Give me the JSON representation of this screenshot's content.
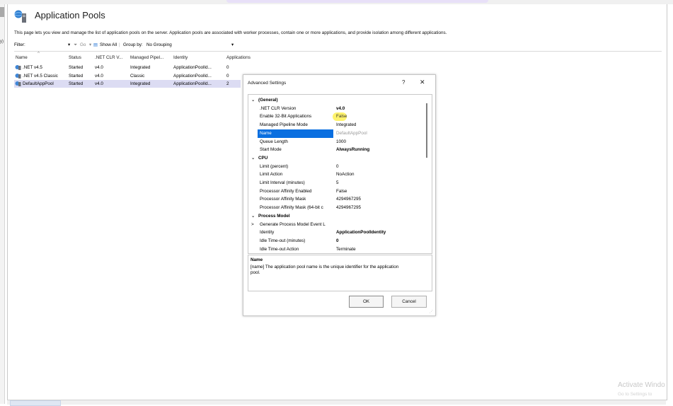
{
  "page": {
    "title": "Application Pools",
    "description": "This page lets you view and manage the list of application pools on the server. Application pools are associated with worker processes, contain one or more applications, and provide isolation among different applications."
  },
  "filterbar": {
    "filter_label": "Filter:",
    "go_label": "Go",
    "show_all_label": "Show All",
    "group_by_label": "Group by:",
    "group_by_value": "No Grouping"
  },
  "grid": {
    "columns": [
      "Name",
      "Status",
      ".NET CLR V...",
      "Managed Pipel...",
      "Identity",
      "Applications"
    ],
    "rows": [
      {
        "name": ".NET v4.5",
        "status": "Started",
        "clr": "v4.0",
        "pipeline": "Integrated",
        "identity": "ApplicationPoolId...",
        "apps": "0"
      },
      {
        "name": ".NET v4.5 Classic",
        "status": "Started",
        "clr": "v4.0",
        "pipeline": "Classic",
        "identity": "ApplicationPoolId...",
        "apps": "0"
      },
      {
        "name": "DefaultAppPool",
        "status": "Started",
        "clr": "v4.0",
        "pipeline": "Integrated",
        "identity": "ApplicationPoolId...",
        "apps": "2"
      }
    ],
    "selected_row": 2
  },
  "dialog": {
    "title": "Advanced Settings",
    "help": "?",
    "close": "✕",
    "properties": [
      {
        "type": "cat",
        "expander": "⌄",
        "label": "(General)"
      },
      {
        "type": "prop",
        "key": ".NET CLR Version",
        "value": "v4.0",
        "bold": true
      },
      {
        "type": "prop",
        "key": "Enable 32-Bit Applications",
        "value": "False",
        "highlight": true
      },
      {
        "type": "prop",
        "key": "Managed Pipeline Mode",
        "value": "Integrated"
      },
      {
        "type": "prop",
        "key": "Name",
        "value": "DefaultAppPool",
        "selected": true
      },
      {
        "type": "prop",
        "key": "Queue Length",
        "value": "1000"
      },
      {
        "type": "prop",
        "key": "Start Mode",
        "value": "AlwaysRunning",
        "bold": true
      },
      {
        "type": "cat",
        "expander": "⌄",
        "label": "CPU"
      },
      {
        "type": "prop",
        "key": "Limit (percent)",
        "value": "0"
      },
      {
        "type": "prop",
        "key": "Limit Action",
        "value": "NoAction"
      },
      {
        "type": "prop",
        "key": "Limit Interval (minutes)",
        "value": "5"
      },
      {
        "type": "prop",
        "key": "Processor Affinity Enabled",
        "value": "False"
      },
      {
        "type": "prop",
        "key": "Processor Affinity Mask",
        "value": "4294967295"
      },
      {
        "type": "prop",
        "key": "Processor Affinity Mask (64-bit c",
        "value": "4294967295"
      },
      {
        "type": "cat",
        "expander": "⌄",
        "label": "Process Model"
      },
      {
        "type": "sub",
        "expander": ">",
        "key": "Generate Process Model Event L",
        "value": ""
      },
      {
        "type": "prop",
        "key": "Identity",
        "value": "ApplicationPoolIdentity",
        "bold": true
      },
      {
        "type": "prop",
        "key": "Idle Time-out (minutes)",
        "value": "0",
        "bold": true
      },
      {
        "type": "prop",
        "key": "Idle Time-out Action",
        "value": "Terminate"
      }
    ],
    "description_heading": "Name",
    "description_body": "[name] The application pool name is the unique identifier for the application pool.",
    "ok_label": "OK",
    "cancel_label": "Cancel"
  },
  "watermark": {
    "line1": "Activate Windo",
    "line2": "Go to Settings to"
  }
}
